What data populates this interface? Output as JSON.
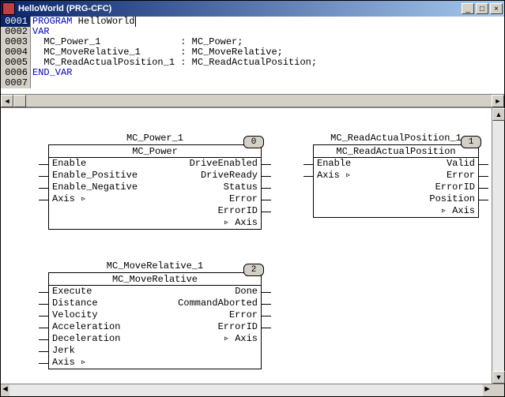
{
  "window": {
    "title": "HelloWorld (PRG-CFC)",
    "min": "_",
    "max": "□",
    "close": "×"
  },
  "code": {
    "lines": [
      {
        "num": "0001",
        "pre": "",
        "kw": "PROGRAM",
        "rest": " HelloWorld"
      },
      {
        "num": "0002",
        "pre": "",
        "kw": "VAR",
        "rest": ""
      },
      {
        "num": "0003",
        "pre": "  MC_Power_1              : MC_Power;",
        "kw": "",
        "rest": ""
      },
      {
        "num": "0004",
        "pre": "  MC_MoveRelative_1       : MC_MoveRelative;",
        "kw": "",
        "rest": ""
      },
      {
        "num": "0005",
        "pre": "  MC_ReadActualPosition_1 : MC_ReadActualPosition;",
        "kw": "",
        "rest": ""
      },
      {
        "num": "0006",
        "pre": "",
        "kw": "END_VAR",
        "rest": ""
      },
      {
        "num": "0007",
        "pre": "",
        "kw": "",
        "rest": ""
      }
    ]
  },
  "blocks": {
    "b0": {
      "instance": "MC_Power_1",
      "type": "MC_Power",
      "tag": "0",
      "left": [
        "Enable",
        "Enable_Positive",
        "Enable_Negative",
        "Axis ▹"
      ],
      "right": [
        "DriveEnabled",
        "DriveReady",
        "Status",
        "Error",
        "ErrorID",
        "▹ Axis"
      ]
    },
    "b1": {
      "instance": "MC_ReadActualPosition_1",
      "type": "MC_ReadActualPosition",
      "tag": "1",
      "left": [
        "Enable",
        "Axis ▹"
      ],
      "right": [
        "Valid",
        "Error",
        "ErrorID",
        "Position",
        "▹ Axis"
      ]
    },
    "b2": {
      "instance": "MC_MoveRelative_1",
      "type": "MC_MoveRelative",
      "tag": "2",
      "left": [
        "Execute",
        "Distance",
        "Velocity",
        "Acceleration",
        "Deceleration",
        "Jerk",
        "Axis ▹"
      ],
      "right": [
        "Done",
        "CommandAborted",
        "Error",
        "ErrorID",
        "▹ Axis"
      ]
    }
  }
}
